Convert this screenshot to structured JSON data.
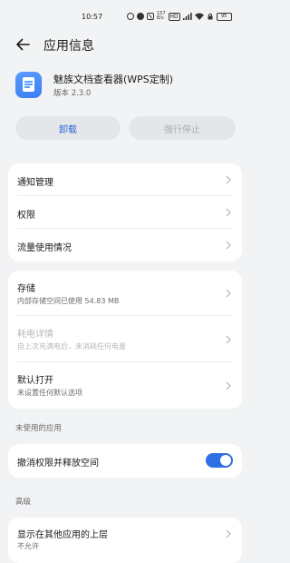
{
  "status_bar": {
    "time": "10:57",
    "speed_value": "157",
    "speed_unit": "B/s",
    "hd_label": "HD",
    "battery": "95"
  },
  "header": {
    "title": "应用信息"
  },
  "app": {
    "name": "魅族文档查看器(WPS定制)",
    "version": "版本 2.3.0"
  },
  "actions": {
    "uninstall": "卸载",
    "force_stop": "强行停止"
  },
  "card1": {
    "items": [
      {
        "label": "通知管理"
      },
      {
        "label": "权限"
      },
      {
        "label": "流量使用情况"
      }
    ]
  },
  "card2": {
    "storage": {
      "label": "存储",
      "sub": "内部存储空间已使用 54.83 MB"
    },
    "battery": {
      "label": "耗电详情",
      "sub": "自上次充满电后，未消耗任何电量"
    },
    "default_open": {
      "label": "默认打开",
      "sub": "未设置任何默认选项"
    }
  },
  "unused_section": {
    "title": "未使用的应用",
    "revoke": {
      "label": "撤消权限并释放空间",
      "enabled": true
    }
  },
  "advanced_section": {
    "title": "高级",
    "overlay": {
      "label": "显示在其他应用的上层",
      "sub": "不允许"
    }
  },
  "colors": {
    "accent": "#2f6fe4",
    "background": "#f1f3f5",
    "card": "#ffffff"
  }
}
